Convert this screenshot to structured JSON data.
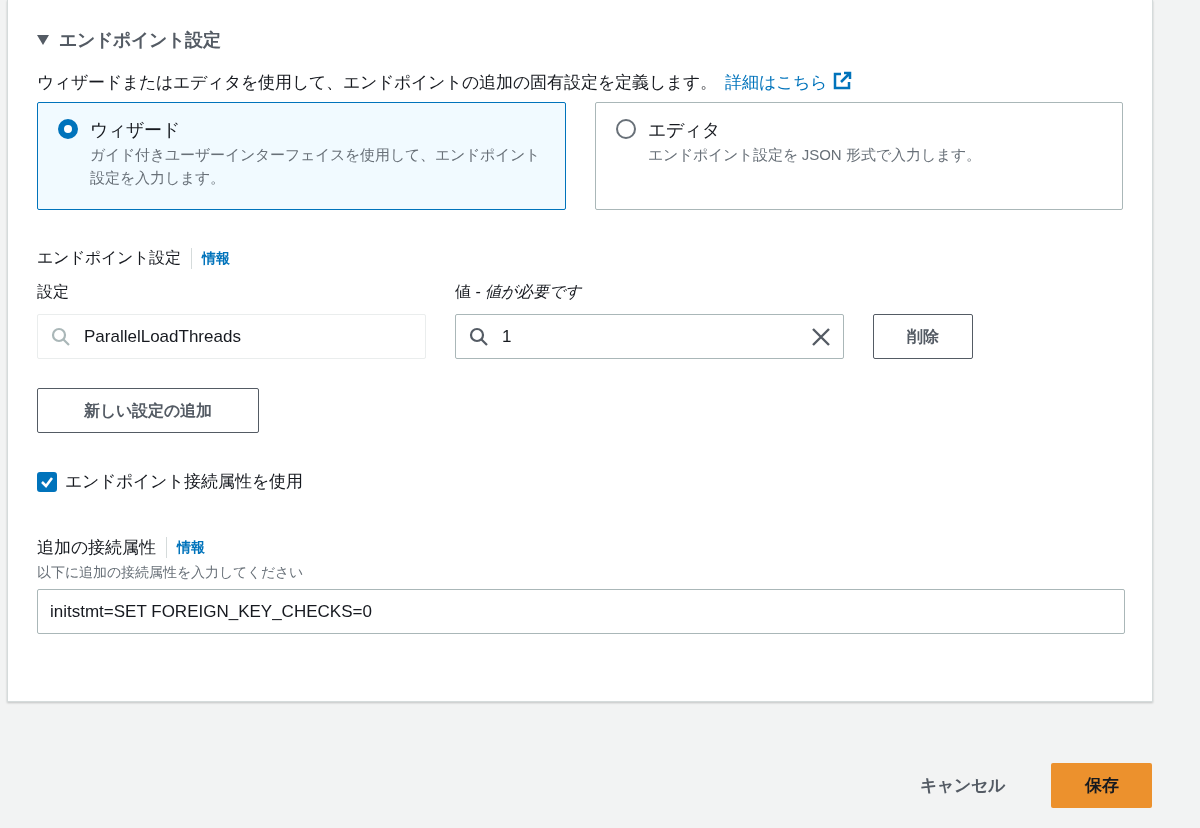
{
  "section": {
    "title": "エンドポイント設定",
    "expanded": true,
    "description": "ウィザードまたはエディタを使用して、エンドポイントの追加の固有設定を定義します。",
    "learn_more": "詳細はこちら",
    "modes": [
      {
        "label": "ウィザード",
        "description": "ガイド付きユーザーインターフェイスを使用して、エンドポイント設定を入力します。",
        "selected": true
      },
      {
        "label": "エディタ",
        "description": "エンドポイント設定を JSON 形式で入力します。",
        "selected": false
      }
    ],
    "settings": {
      "label": "エンドポイント設定",
      "info": "情報",
      "key_label": "設定",
      "value_label": "値 - *値が必要です*",
      "rows": [
        {
          "key": "ParallelLoadThreads",
          "value": "1",
          "remove": "削除"
        }
      ],
      "add_button": "新しい設定の追加"
    },
    "use_attributes": {
      "label": "エンドポイント接続属性を使用",
      "checked": true
    },
    "extra_attributes": {
      "label": "追加の接続属性",
      "info": "情報",
      "hint": "以下に追加の接続属性を入力してください",
      "value": "initstmt=SET FOREIGN_KEY_CHECKS=0"
    }
  },
  "footer": {
    "cancel": "キャンセル",
    "save": "保存"
  }
}
